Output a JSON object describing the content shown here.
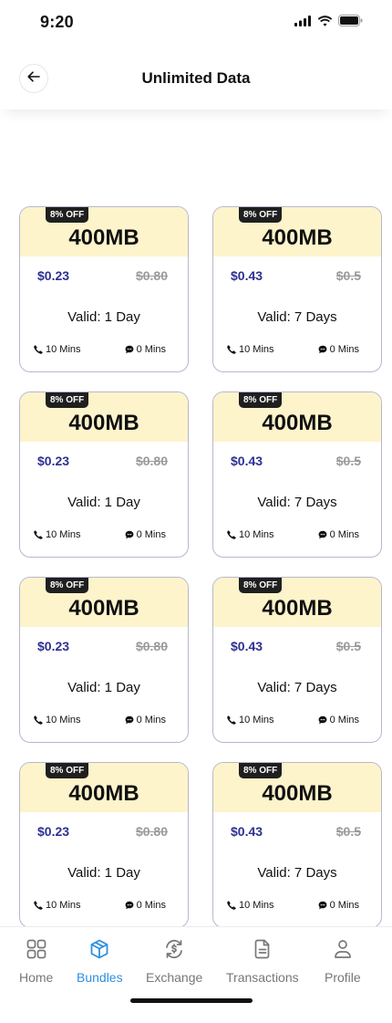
{
  "status_bar": {
    "time": "9:20"
  },
  "header": {
    "title": "Unlimited Data"
  },
  "cards": [
    {
      "badge": "8% OFF",
      "amount": "400MB",
      "price_new": "$0.23",
      "price_old": "$0.80",
      "validity": "Valid: 1 Day",
      "call_mins": "10 Mins",
      "sms_mins": "0 Mins"
    },
    {
      "badge": "8% OFF",
      "amount": "400MB",
      "price_new": "$0.43",
      "price_old": "$0.5",
      "validity": "Valid: 7 Days",
      "call_mins": "10 Mins",
      "sms_mins": "0 Mins"
    },
    {
      "badge": "8% OFF",
      "amount": "400MB",
      "price_new": "$0.23",
      "price_old": "$0.80",
      "validity": "Valid: 1 Day",
      "call_mins": "10 Mins",
      "sms_mins": "0 Mins"
    },
    {
      "badge": "8% OFF",
      "amount": "400MB",
      "price_new": "$0.43",
      "price_old": "$0.5",
      "validity": "Valid: 7 Days",
      "call_mins": "10 Mins",
      "sms_mins": "0 Mins"
    },
    {
      "badge": "8% OFF",
      "amount": "400MB",
      "price_new": "$0.23",
      "price_old": "$0.80",
      "validity": "Valid: 1 Day",
      "call_mins": "10 Mins",
      "sms_mins": "0 Mins"
    },
    {
      "badge": "8% OFF",
      "amount": "400MB",
      "price_new": "$0.43",
      "price_old": "$0.5",
      "validity": "Valid: 7 Days",
      "call_mins": "10 Mins",
      "sms_mins": "0 Mins"
    },
    {
      "badge": "8% OFF",
      "amount": "400MB",
      "price_new": "$0.23",
      "price_old": "$0.80",
      "validity": "Valid: 1 Day",
      "call_mins": "10 Mins",
      "sms_mins": "0 Mins"
    },
    {
      "badge": "8% OFF",
      "amount": "400MB",
      "price_new": "$0.43",
      "price_old": "$0.5",
      "validity": "Valid: 7 Days",
      "call_mins": "10 Mins",
      "sms_mins": "0 Mins"
    }
  ],
  "nav": {
    "items": [
      {
        "label": "Home",
        "icon": "grid-icon",
        "active": false
      },
      {
        "label": "Bundles",
        "icon": "box-icon",
        "active": true
      },
      {
        "label": "Exchange",
        "icon": "exchange-icon",
        "active": false
      },
      {
        "label": "Transactions",
        "icon": "document-icon",
        "active": false
      },
      {
        "label": "Profile",
        "icon": "user-icon",
        "active": false
      }
    ]
  },
  "colors": {
    "accent": "#2f8fe0",
    "price": "#2e3192",
    "card_top": "#fdf4cb",
    "badge_bg": "#1f1f1f",
    "card_border": "#b8b6cf"
  }
}
